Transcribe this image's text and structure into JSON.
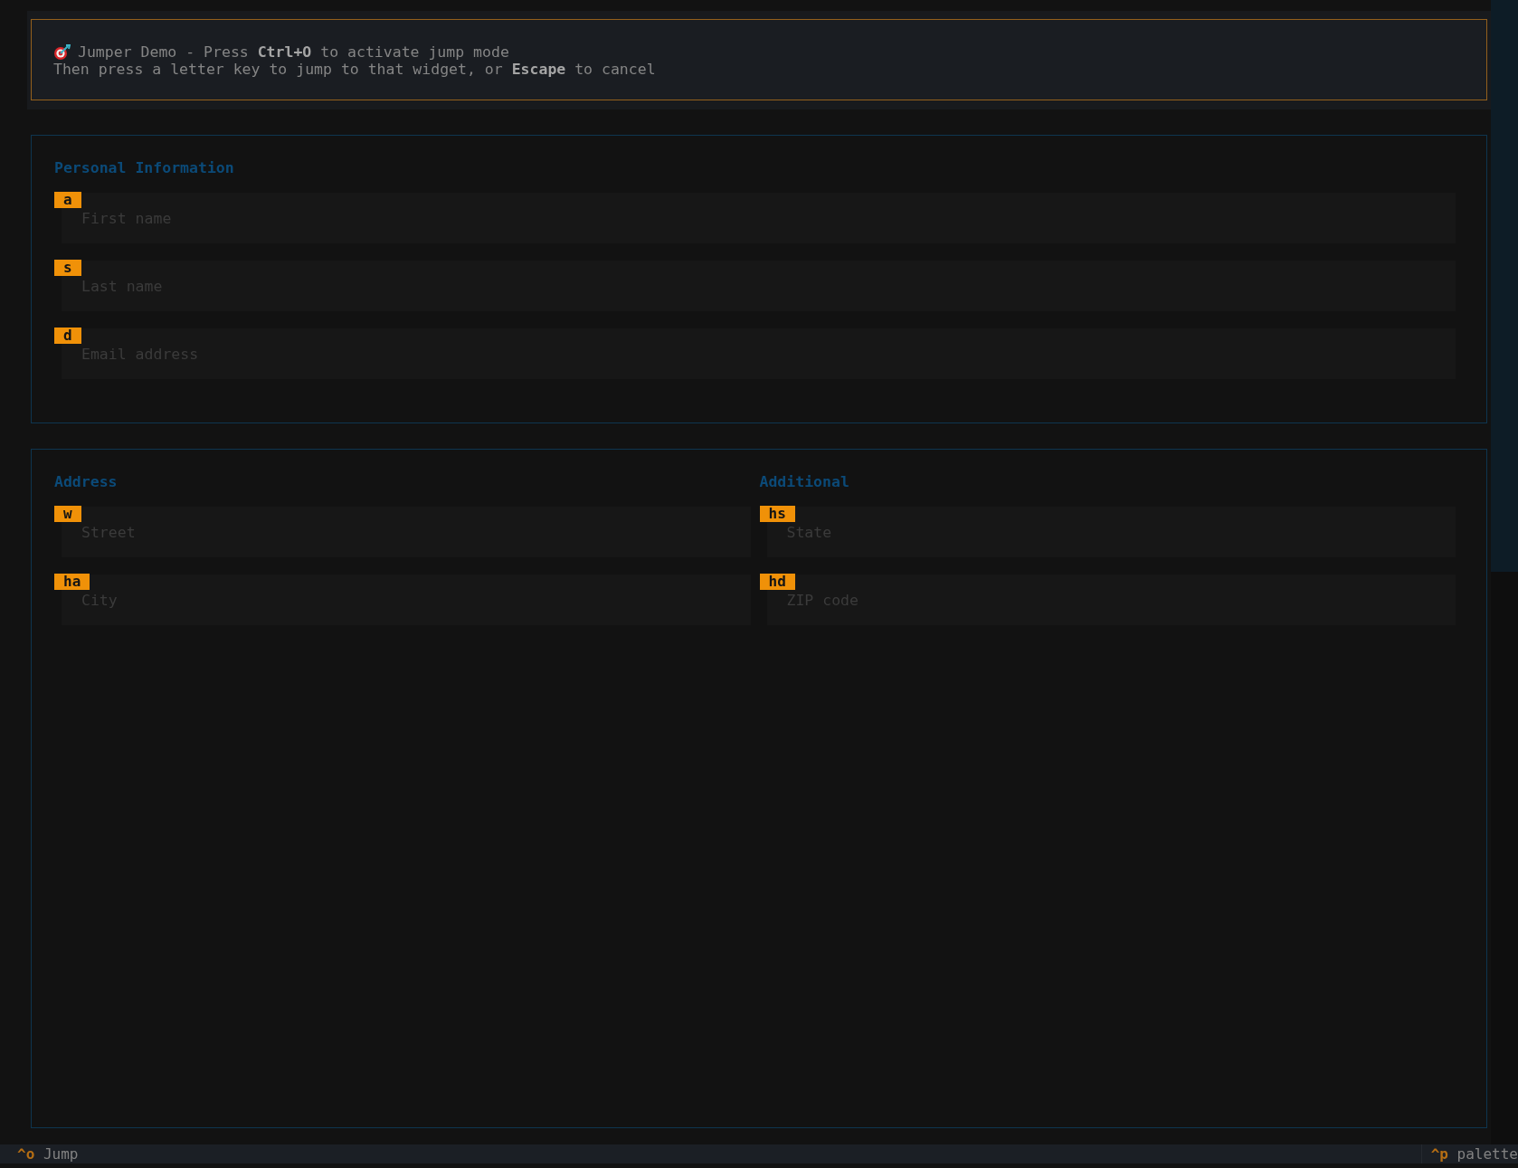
{
  "header": {
    "line_1": "Jumper Demo - Press **Ctrl+O** to activate jump mode",
    "line_2": "Then press a letter key to jump to that widget, or **Escape** to cancel"
  },
  "personal": {
    "title": "Personal Information",
    "fields": [
      {
        "hint": "a",
        "placeholder": "First name"
      },
      {
        "hint": "s",
        "placeholder": "Last name"
      },
      {
        "hint": "d",
        "placeholder": "Email address"
      }
    ]
  },
  "address_columns": [
    {
      "title": "Address",
      "fields": [
        {
          "hint": "w",
          "placeholder": "Street"
        },
        {
          "hint": "ha",
          "placeholder": "City"
        }
      ]
    },
    {
      "title": "Additional",
      "fields": [
        {
          "hint": "hs",
          "placeholder": "State"
        },
        {
          "hint": "hd",
          "placeholder": "ZIP code"
        }
      ]
    }
  ],
  "footer": {
    "left": {
      "key": "^o",
      "label": "Jump"
    },
    "right": {
      "key": "^p",
      "label": "palette"
    }
  }
}
